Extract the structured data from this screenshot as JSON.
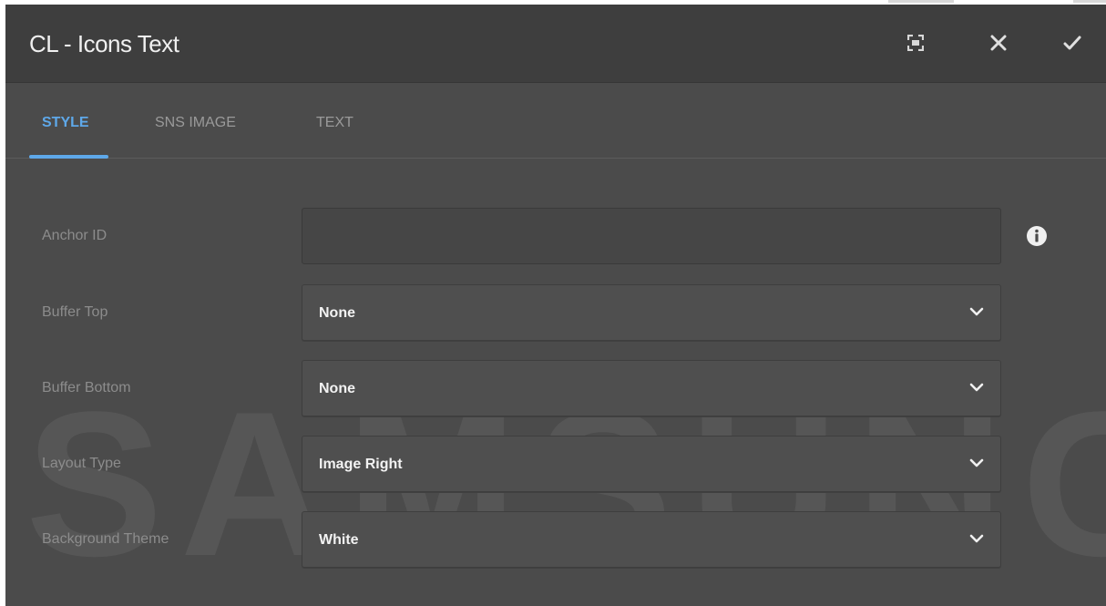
{
  "window": {
    "title": "CL - Icons Text",
    "icons": [
      "fullscreen-icon",
      "close-icon",
      "checkmark-icon"
    ]
  },
  "tabs": [
    {
      "label": "STYLE",
      "active": true
    },
    {
      "label": "SNS IMAGE",
      "active": false
    },
    {
      "label": "TEXT",
      "active": false
    }
  ],
  "watermark": "SAMSUNG",
  "form": {
    "anchor_id": {
      "label": "Anchor ID",
      "value": ""
    },
    "buffer_top": {
      "label": "Buffer Top",
      "value": "None"
    },
    "buffer_bottom": {
      "label": "Buffer Bottom",
      "value": "None"
    },
    "layout_type": {
      "label": "Layout Type",
      "value": "Image Right"
    },
    "background_theme": {
      "label": "Background Theme",
      "value": "White"
    }
  },
  "colors": {
    "accent": "#5ea8e9",
    "dialog_bg": "#4b4b4b",
    "titlebar_bg": "#3e3e3e"
  }
}
